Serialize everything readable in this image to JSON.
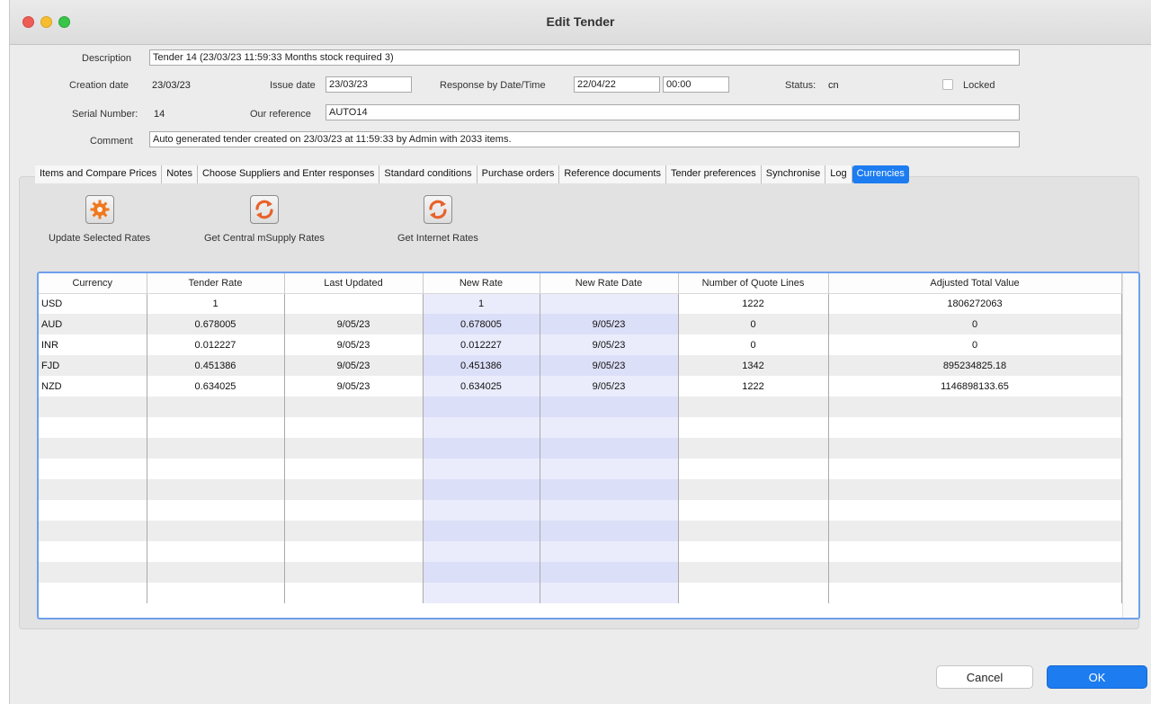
{
  "window": {
    "title": "Edit Tender"
  },
  "header": {
    "description_label": "Description",
    "description_value": "Tender 14 (23/03/23 11:59:33 Months stock required 3)",
    "creation_date_label": "Creation date",
    "creation_date_value": "23/03/23",
    "issue_date_label": "Issue date",
    "issue_date_value": "23/03/23",
    "response_label": "Response by Date/Time",
    "response_date_value": "22/04/22",
    "response_time_value": "00:00",
    "status_label": "Status:",
    "status_value": "cn",
    "locked_label": "Locked",
    "locked_checked": false,
    "serial_label": "Serial Number:",
    "serial_value": "14",
    "reference_label": "Our reference",
    "reference_value": "AUTO14",
    "comment_label": "Comment",
    "comment_value": "Auto generated tender created on 23/03/23 at 11:59:33 by Admin with 2033 items."
  },
  "tabs": [
    {
      "label": "Items and Compare Prices",
      "active": false
    },
    {
      "label": "Notes",
      "active": false
    },
    {
      "label": "Choose Suppliers and Enter responses",
      "active": false
    },
    {
      "label": "Standard conditions",
      "active": false
    },
    {
      "label": "Purchase orders",
      "active": false
    },
    {
      "label": "Reference documents",
      "active": false
    },
    {
      "label": "Tender preferences",
      "active": false
    },
    {
      "label": "Synchronise",
      "active": false
    },
    {
      "label": "Log",
      "active": false
    },
    {
      "label": "Currencies",
      "active": true
    }
  ],
  "toolbar": {
    "update_rates_label": "Update Selected Rates",
    "central_rates_label": "Get Central mSupply Rates",
    "internet_rates_label": "Get Internet Rates"
  },
  "table": {
    "columns": [
      "Currency",
      "Tender Rate",
      "Last Updated",
      "New Rate",
      "New Rate Date",
      "Number of Quote Lines",
      "Adjusted Total Value"
    ],
    "rows": [
      [
        "USD",
        "1",
        "",
        "1",
        "",
        "1222",
        "1806272063"
      ],
      [
        "AUD",
        "0.678005",
        "9/05/23",
        "0.678005",
        "9/05/23",
        "0",
        "0"
      ],
      [
        "INR",
        "0.012227",
        "9/05/23",
        "0.012227",
        "9/05/23",
        "0",
        "0"
      ],
      [
        "FJD",
        "0.451386",
        "9/05/23",
        "0.451386",
        "9/05/23",
        "1342",
        "895234825.18"
      ],
      [
        "NZD",
        "0.634025",
        "9/05/23",
        "0.634025",
        "9/05/23",
        "1222",
        "1146898133.65"
      ]
    ]
  },
  "footer": {
    "cancel_label": "Cancel",
    "ok_label": "OK"
  },
  "colors": {
    "accent": "#1c7cf0",
    "grid_focus": "#6ea0ec",
    "editable_column": "#eaecfc"
  }
}
